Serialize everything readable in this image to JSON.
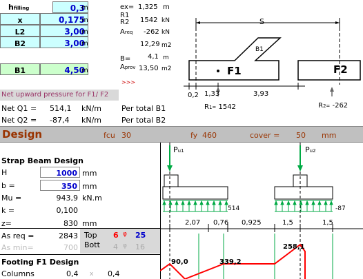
{
  "inputs": {
    "h_filling": {
      "label": "h",
      "sub": "filling",
      "value": "0,3",
      "unit": "m"
    },
    "x": {
      "label": "x",
      "value": "0,175",
      "unit": "m"
    },
    "L2": {
      "label": "L2",
      "value": "3,00",
      "unit": "m"
    },
    "B2": {
      "label": "B2",
      "value": "3,00",
      "unit": "m"
    },
    "B1": {
      "label": "B1",
      "value": "4,50",
      "unit": "m"
    }
  },
  "results_top": {
    "ex": {
      "label": "ex=",
      "value": "1,325",
      "unit": "m"
    },
    "R1": {
      "label": "R1",
      "value": "",
      "unit": ""
    },
    "R2": {
      "label": "R2",
      "value": "1542",
      "unit": "kN"
    },
    "Areq": {
      "label": "A",
      "sub": "req",
      "value": "-262",
      "unit": "kN"
    },
    "area": {
      "value": "12,29",
      "unit": "m2"
    },
    "B": {
      "label": "B=",
      "value": "4,1",
      "unit": "m"
    },
    "Aprov": {
      "label": "A",
      "sub": "prov",
      "value": "13,50",
      "unit": "m2"
    },
    "arrows": ">>>"
  },
  "sketch": {
    "S_label": "S",
    "B1_label": "B1",
    "F1_label": "F1",
    "F2_label": "F2",
    "dim_02": "0,2",
    "dim_133": "1,33",
    "dim_393": "3,93",
    "R1_label": "R",
    "R1_sub": "1=",
    "R1_value": "1542",
    "R2_label": "R",
    "R2_sub": "2=",
    "R2_value": "-262"
  },
  "net_pressure": {
    "header": "Net upward pressure for F1/ F2",
    "q1_label": "Net Q1 =",
    "q1_value": "514,1",
    "q1_unit": "kN/m",
    "q1_note": "Per total B1",
    "q2_label": "Net Q2 =",
    "q2_value": "-87,4",
    "q2_unit": "kN/m",
    "q2_note": "Per total B2"
  },
  "design_bar": {
    "title": "Design",
    "fcu_label": "fcu",
    "fcu_value": "30",
    "fy_label": "fy",
    "fy_value": "460",
    "cover_label": "cover =",
    "cover_value": "50",
    "cover_unit": "mm"
  },
  "strap": {
    "title": "Strap  Beam Design",
    "H_label": "H",
    "H_value": "1000",
    "H_unit": "mm",
    "b_label": "b =",
    "b_value": "350",
    "b_unit": "mm",
    "Mu_label": "Mu =",
    "Mu_value": "943,9",
    "Mu_unit": "kN.m",
    "k_label": "k =",
    "k_value": "0,100",
    "z_label": "z=",
    "z_value": "830",
    "z_unit": "mm",
    "asreq_label": "As req =",
    "asreq_value": "2843",
    "top_label": "Top",
    "top_n": "6",
    "top_phi": "φ",
    "top_d": "25",
    "asmin_label": "As min=",
    "asmin_value": "700",
    "bott_label": "Bott",
    "bott_n": "4",
    "bott_phi": "φ",
    "bott_d": "16"
  },
  "footing": {
    "title": "Footing F1 Design",
    "col_label": "Columns",
    "col_v1": "0,4",
    "col_x": "x",
    "col_v2": "0,4"
  },
  "diagram": {
    "pu1": "P",
    "pu1_sub": "u1",
    "pu2": "P",
    "pu2_sub": "u2",
    "load1": "514",
    "load2": "-87",
    "dims": [
      "2,07",
      "0,76",
      "0,925",
      "1,5",
      "1,5"
    ],
    "m1": "90,0",
    "m2": "339,2",
    "m3": "258,1"
  },
  "colors": {
    "input_fill": "#ccffff",
    "input_green": "#ccffcc",
    "design_bar": "#c0c0c0",
    "design_title": "#993300",
    "pressure_header": "#993366",
    "grid_green": "#00aa44",
    "moment_red": "#ff0000"
  }
}
